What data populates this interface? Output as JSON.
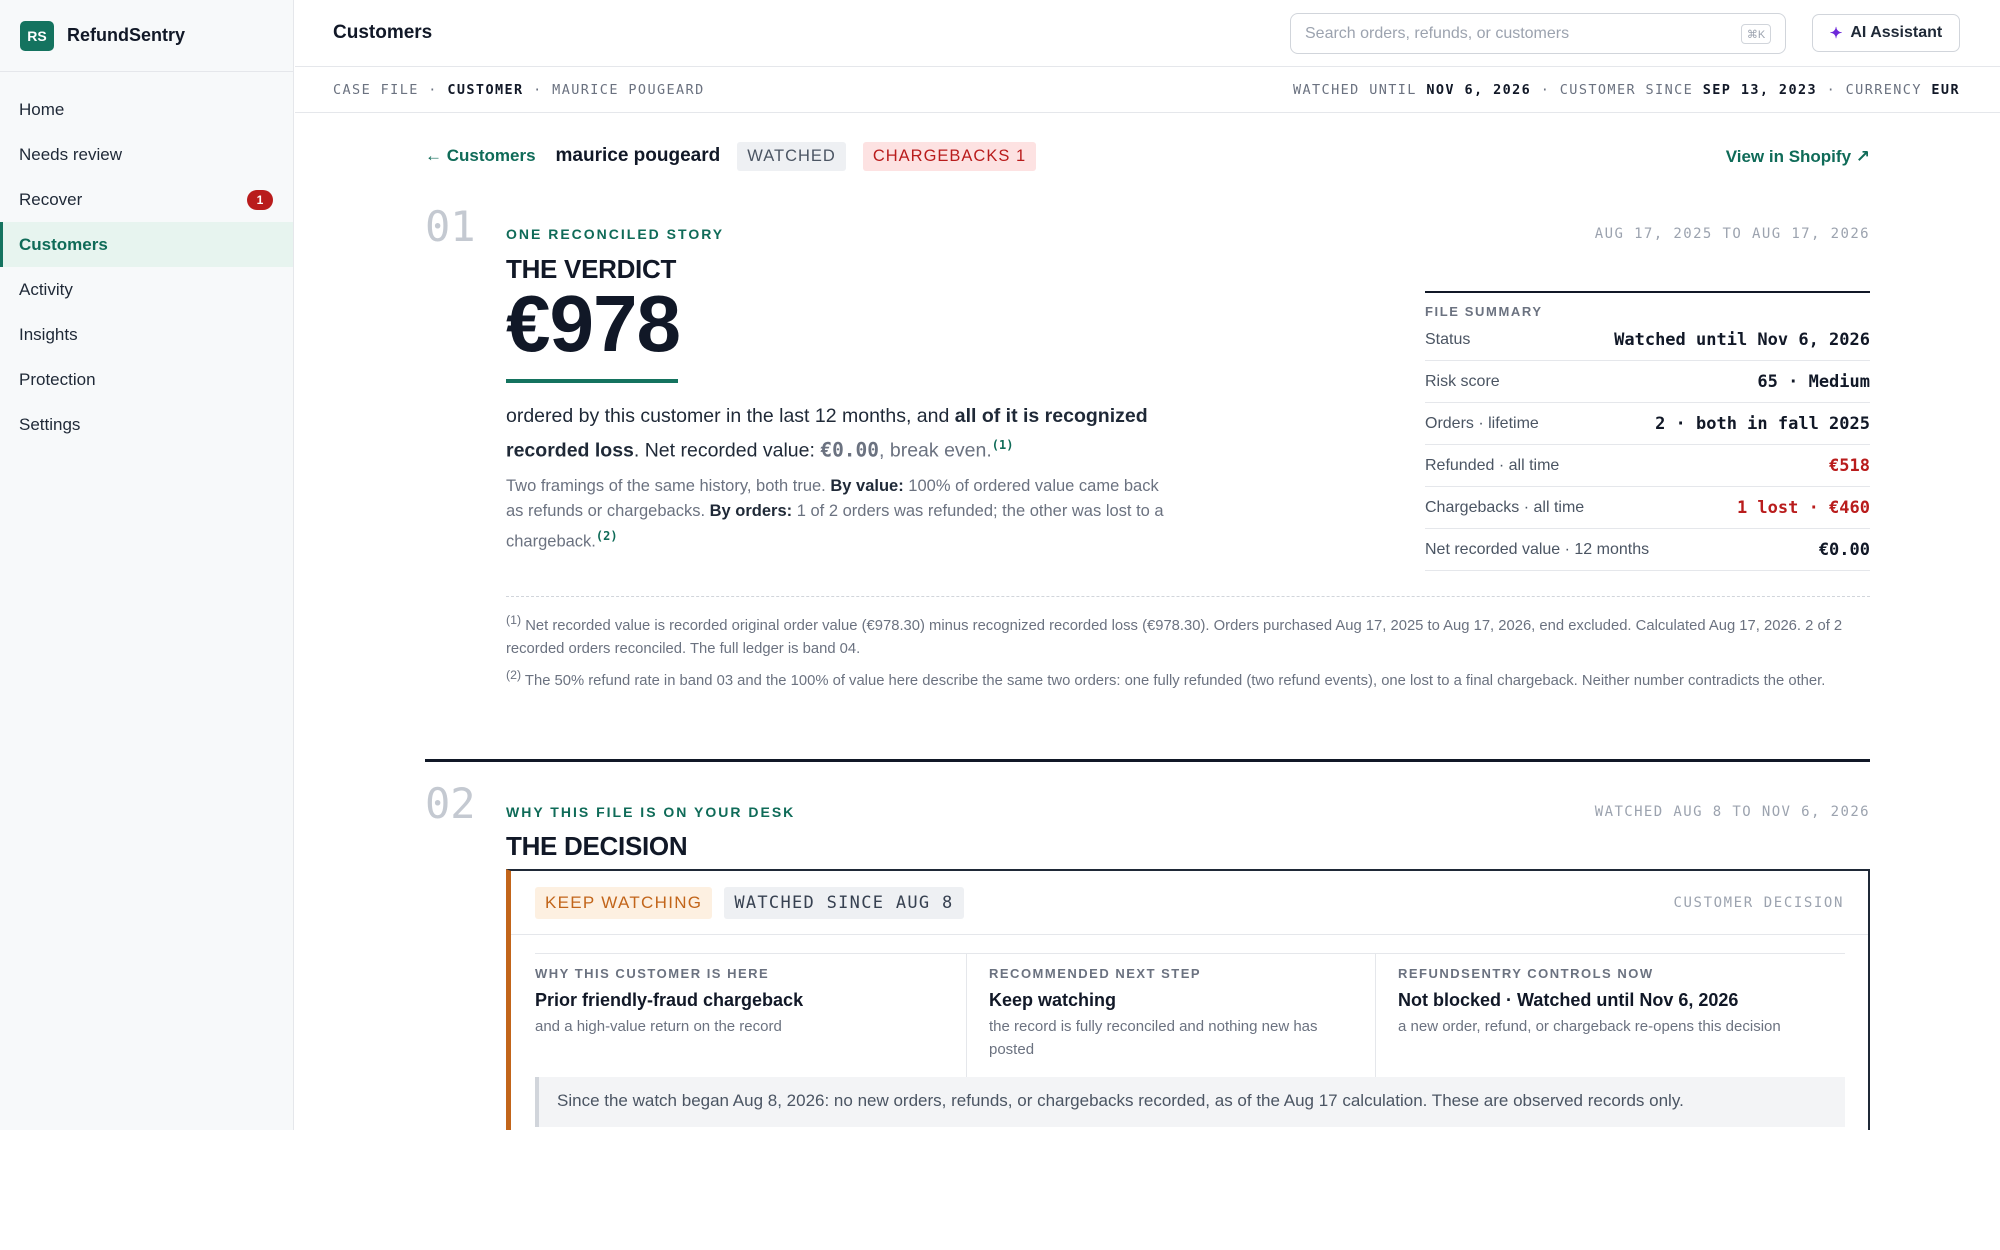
{
  "app": {
    "logo_initials": "RS",
    "name": "RefundSentry"
  },
  "sidebar": {
    "items": [
      {
        "label": "Home"
      },
      {
        "label": "Needs review"
      },
      {
        "label": "Recover",
        "badge": "1"
      },
      {
        "label": "Customers",
        "active": true
      },
      {
        "label": "Activity"
      },
      {
        "label": "Insights"
      },
      {
        "label": "Protection"
      },
      {
        "label": "Settings"
      }
    ]
  },
  "header": {
    "title": "Customers",
    "search_placeholder": "Search orders, refunds, or customers",
    "search_shortcut": "⌘K",
    "ai_label": "AI Assistant"
  },
  "casebar": {
    "case_file": "CASE FILE",
    "sep": "·",
    "customer_label": "CUSTOMER",
    "customer_name": "MAURICE POUGEARD",
    "watched_label": "WATCHED UNTIL",
    "watched_value": "NOV 6, 2026",
    "since_label": "CUSTOMER SINCE",
    "since_value": "SEP 13, 2023",
    "currency_label": "CURRENCY",
    "currency_value": "EUR"
  },
  "customer": {
    "back_label": "← Customers",
    "name": "maurice pougeard",
    "tag_watched": "WATCHED",
    "tag_chargebacks": "CHARGEBACKS 1",
    "shopify_label": "View in Shopify ↗"
  },
  "verdict": {
    "number": "01",
    "eyebrow": "ONE RECONCILED STORY",
    "title": "THE VERDICT",
    "date_range": "AUG 17, 2025 TO AUG 17, 2026",
    "amount": "€978",
    "text_1": "ordered by this customer in the last 12 months, and ",
    "text_bold": "all of it is recognized recorded loss",
    "text_2": ". Net recorded value: ",
    "text_value": "€0.00",
    "text_3": ", break even.",
    "ref_1": "(1)",
    "framing_1": "Two framings of the same history, both true. ",
    "framing_b1": "By value:",
    "framing_2": " 100% of ordered value came back as refunds or chargebacks. ",
    "framing_b2": "By orders:",
    "framing_3": " 1 of 2 orders was refunded; the other was lost to a chargeback.",
    "ref_2": "(2)"
  },
  "summary": {
    "title": "FILE SUMMARY",
    "rows": [
      {
        "label": "Status",
        "value": "Watched until Nov 6, 2026"
      },
      {
        "label": "Risk score",
        "value": "65 · Medium"
      },
      {
        "label": "Orders · lifetime",
        "value": "2 · both in fall 2025"
      },
      {
        "label": "Refunded · all time",
        "value": "€518"
      },
      {
        "label": "Chargebacks · all time",
        "value": "1 lost · €460"
      },
      {
        "label": "Net recorded value · 12 months",
        "value": "€0.00"
      }
    ]
  },
  "footnotes": {
    "fn1_ref": "(1)",
    "fn1": "Net recorded value is recorded original order value (€978.30) minus recognized recorded loss (€978.30). Orders purchased Aug 17, 2025 to Aug 17, 2026, end excluded. Calculated Aug 17, 2026. 2 of 2 recorded orders reconciled. The full ledger is band 04.",
    "fn2_ref": "(2)",
    "fn2": "The 50% refund rate in band 03 and the 100% of value here describe the same two orders: one fully refunded (two refund events), one lost to a final chargeback. Neither number contradicts the other."
  },
  "decision": {
    "number": "02",
    "eyebrow": "WHY THIS FILE IS ON YOUR DESK",
    "title": "THE DECISION",
    "date_range": "WATCHED AUG 8 TO NOV 6, 2026",
    "tag_keep": "KEEP WATCHING",
    "tag_since": "WATCHED SINCE AUG 8",
    "box_label": "CUSTOMER DECISION",
    "cols": [
      {
        "eyebrow": "WHY THIS CUSTOMER IS HERE",
        "title": "Prior friendly-fraud chargeback",
        "sub": "and a high-value return on the record"
      },
      {
        "eyebrow": "RECOMMENDED NEXT STEP",
        "title": "Keep watching",
        "sub": "the record is fully reconciled and nothing new has posted"
      },
      {
        "eyebrow": "REFUNDSENTRY CONTROLS NOW",
        "title": "Not blocked · Watched until Nov 6, 2026",
        "sub": "a new order, refund, or chargeback re-opens this decision"
      }
    ],
    "observed": "Since the watch began Aug 8, 2026: no new orders, refunds, or chargebacks recorded, as of the Aug 17 calculation. These are observed records only."
  },
  "colors": {
    "accent": "#14735f",
    "danger": "#b91c1c",
    "warning": "#c2651a"
  }
}
